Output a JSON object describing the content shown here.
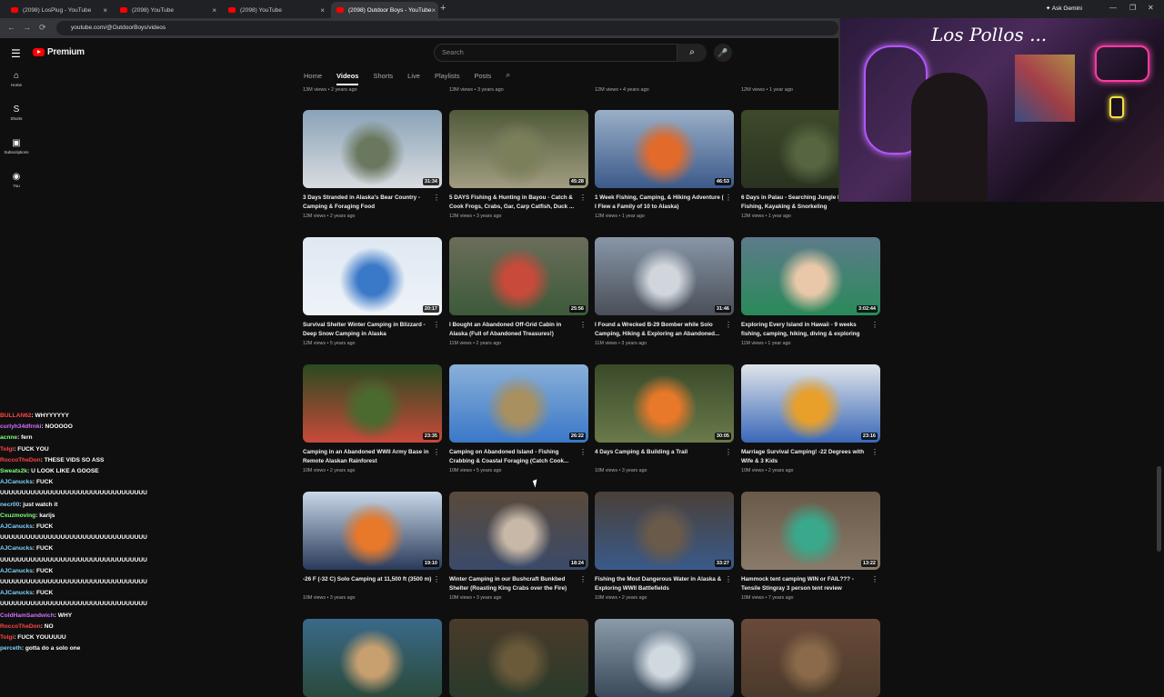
{
  "browser": {
    "tabs": [
      {
        "label": "(2098) LosPlug - YouTube",
        "active": false
      },
      {
        "label": "(2098) YouTube",
        "active": false
      },
      {
        "label": "(2098) YouTube",
        "active": false
      },
      {
        "label": "(2098) Outdoor Boys - YouTube",
        "active": true
      }
    ],
    "new_tab": "+",
    "url": "youtube.com/@OutdoorBoys/videos",
    "gemini": "Ask Gemini",
    "back": "←",
    "forward": "→",
    "reload": "⟳"
  },
  "masthead": {
    "logo": "Premium",
    "search_placeholder": "Search",
    "search_icon": "⌕",
    "mic_icon": "🎤",
    "menu_icon": "☰"
  },
  "sidebar": [
    {
      "icon": "⌂",
      "label": "Home"
    },
    {
      "icon": "S",
      "label": "Shorts"
    },
    {
      "icon": "▣",
      "label": "Subscriptions"
    },
    {
      "icon": "◉",
      "label": "You"
    }
  ],
  "channel_tabs": [
    "Home",
    "Videos",
    "Shorts",
    "Live",
    "Playlists",
    "Posts"
  ],
  "active_channel_tab": "Videos",
  "top_meta": [
    "13M views • 2 years ago",
    "13M views • 3 years ago",
    "12M views • 4 years ago",
    "12M views • 1 year ago"
  ],
  "videos": [
    {
      "title": "3 Days Stranded in Alaska's Bear Country - Camping & Foraging Food",
      "meta": "12M views • 2 years ago",
      "duration": "31:34",
      "colors": [
        "#8aa3b8",
        "#6a7860",
        "#d9dce0"
      ]
    },
    {
      "title": "5 DAYS Fishing & Hunting in Bayou - Catch & Cook Frogs, Crabs, Gar, Carp Catfish, Duck ...",
      "meta": "12M views • 3 years ago",
      "duration": "45:28",
      "colors": [
        "#4f5a3a",
        "#7b7f5a",
        "#a19c80"
      ]
    },
    {
      "title": "1 Week Fishing, Camping, & Hiking Adventure ( I Flew a Family of 10 to Alaska)",
      "meta": "12M views • 1 year ago",
      "duration": "46:53",
      "colors": [
        "#9ab0c7",
        "#e26a2a",
        "#3c5a8a"
      ]
    },
    {
      "title": "6 Days in Palau - Searching Jungle Battlefields, Fishing, Kayaking & Snorkeling",
      "meta": "12M views • 1 year ago",
      "duration": "",
      "colors": [
        "#3d4a2a",
        "#566640",
        "#2a3220"
      ]
    },
    {
      "title": "Survival Shelter Winter Camping in Blizzard - Deep Snow Camping in Alaska",
      "meta": "12M views • 5 years ago",
      "duration": "20:17",
      "colors": [
        "#dfe8f2",
        "#3a78c8",
        "#eef3f8"
      ]
    },
    {
      "title": "I Bought an Abandoned Off-Grid Cabin in Alaska (Full of Abandoned Treasures!)",
      "meta": "11M views • 2 years ago",
      "duration": "25:56",
      "colors": [
        "#6a6d5a",
        "#c84a3a",
        "#3d5a3a"
      ]
    },
    {
      "title": "I Found a Wrecked B-29 Bomber while Solo Camping, Hiking & Exploring an Abandoned...",
      "meta": "11M views • 3 years ago",
      "duration": "31:46",
      "colors": [
        "#8896a8",
        "#d0d6dc",
        "#4a4f58"
      ]
    },
    {
      "title": "Exploring Every Island in Hawaii - 9 weeks fishing, camping, hiking, diving & exploring",
      "meta": "11M views • 1 year ago",
      "duration": "3:02:44",
      "colors": [
        "#5d7b8a",
        "#e8c8a8",
        "#2a8a5a"
      ]
    },
    {
      "title": "Camping in an Abandoned WWII Army Base in Remote Alaskan Rainforest",
      "meta": "10M views • 2 years ago",
      "duration": "23:35",
      "colors": [
        "#2a4a20",
        "#4a6a30",
        "#c84a3a"
      ]
    },
    {
      "title": "Camping on Abandoned Island - Fishing Crabbing & Coastal Foraging (Catch Cook...",
      "meta": "10M views • 5 years ago",
      "duration": "26:22",
      "colors": [
        "#8ab0d8",
        "#a89060",
        "#3a78c8"
      ]
    },
    {
      "title": "4 Days Camping & Building a Trail",
      "meta": "10M views • 3 years ago",
      "duration": "30:05",
      "colors": [
        "#3a4a2a",
        "#e8782a",
        "#6a7a4a"
      ]
    },
    {
      "title": "Marriage Survival Camping! -22 Degrees with Wife & 3 Kids",
      "meta": "10M views • 2 years ago",
      "duration": "23:16",
      "colors": [
        "#dfe4ea",
        "#e8a02a",
        "#3a68b8"
      ]
    },
    {
      "title": "-26 F (-32 C) Solo Camping at 11,500 ft (3500 m)",
      "meta": "10M views • 3 years ago",
      "duration": "19:10",
      "colors": [
        "#c8d8e8",
        "#e8782a",
        "#2a3a5a"
      ]
    },
    {
      "title": "Winter Camping in our Bushcraft Bunkbed Shelter (Roasting King Crabs over the Fire)",
      "meta": "10M views • 3 years ago",
      "duration": "18:24",
      "colors": [
        "#5a4a3a",
        "#c8b8a8",
        "#3a4a6a"
      ]
    },
    {
      "title": "Fishing the Most Dangerous Water in Alaska & Exploring WWII Battlefields",
      "meta": "10M views • 2 years ago",
      "duration": "33:27",
      "colors": [
        "#4a4038",
        "#6a5a4a",
        "#3a5a8a"
      ]
    },
    {
      "title": "Hammock tent camping WIN or FAIL??? - Tensile Stingray 3 person tent review",
      "meta": "10M views • 7 years ago",
      "duration": "13:22",
      "colors": [
        "#6a5a4a",
        "#3aa88a",
        "#8a7a6a"
      ]
    },
    {
      "title": "",
      "meta": "",
      "duration": "",
      "colors": [
        "#3a6a8a",
        "#c8a070",
        "#2a4a3a"
      ]
    },
    {
      "title": "",
      "meta": "",
      "duration": "",
      "colors": [
        "#4a3a2a",
        "#6a5a3a",
        "#2a3a2a"
      ]
    },
    {
      "title": "",
      "meta": "",
      "duration": "",
      "colors": [
        "#8a9aa8",
        "#d0d8e0",
        "#3a4a5a"
      ]
    },
    {
      "title": "",
      "meta": "",
      "duration": "",
      "colors": [
        "#6a4a3a",
        "#8a6a4a",
        "#4a3a2a"
      ]
    }
  ],
  "webcam": {
    "signature": "Los Pollos ..."
  },
  "chat": [
    {
      "user": "BULLAN62",
      "color": "#ff4545",
      "msg": "WHYYYYYY"
    },
    {
      "user": "curlyh34dfrnki",
      "color": "#d070ff",
      "msg": "NOOOOO"
    },
    {
      "user": "acnne",
      "color": "#7fff7f",
      "msg": "fern"
    },
    {
      "user": "Tolgi",
      "color": "#ff4545",
      "msg": "FUCK YOU"
    },
    {
      "user": "RoccoTheDon",
      "color": "#ff4545",
      "msg": "THESE VIDS SO ASS"
    },
    {
      "user": "Sweats2k",
      "color": "#7fff7f",
      "msg": "U LOOK LIKE A GOOSE"
    },
    {
      "user": "AJCanucks",
      "color": "#7fd0ff",
      "msg": "FUCK"
    },
    {
      "user": "",
      "color": "#fff",
      "msg": "UUUUUUUUUUUUUUUUUUUUUUUUUUUUUUUUUU"
    },
    {
      "user": "necr00",
      "color": "#7fd0ff",
      "msg": "just watch it"
    },
    {
      "user": "Cxuzmoving",
      "color": "#7fff7f",
      "msg": "karijs"
    },
    {
      "user": "AJCanucks",
      "color": "#7fd0ff",
      "msg": "FUCK"
    },
    {
      "user": "",
      "color": "#fff",
      "msg": "UUUUUUUUUUUUUUUUUUUUUUUUUUUUUUUUUU"
    },
    {
      "user": "AJCanucks",
      "color": "#7fd0ff",
      "msg": "FUCK"
    },
    {
      "user": "",
      "color": "#fff",
      "msg": "UUUUUUUUUUUUUUUUUUUUUUUUUUUUUUUUUU"
    },
    {
      "user": "AJCanucks",
      "color": "#7fd0ff",
      "msg": "FUCK"
    },
    {
      "user": "",
      "color": "#fff",
      "msg": "UUUUUUUUUUUUUUUUUUUUUUUUUUUUUUUUUU"
    },
    {
      "user": "AJCanucks",
      "color": "#7fd0ff",
      "msg": "FUCK"
    },
    {
      "user": "",
      "color": "#fff",
      "msg": "UUUUUUUUUUUUUUUUUUUUUUUUUUUUUUUUUU"
    },
    {
      "user": "ColdHamSandwich",
      "color": "#d070ff",
      "msg": "WHY"
    },
    {
      "user": "RoccoTheDon",
      "color": "#ff4545",
      "msg": "NO"
    },
    {
      "user": "Tolgi",
      "color": "#ff4545",
      "msg": "FUCK YOUUUUU"
    },
    {
      "user": "perceth",
      "color": "#7fd0ff",
      "msg": "gotta do a solo one"
    }
  ]
}
